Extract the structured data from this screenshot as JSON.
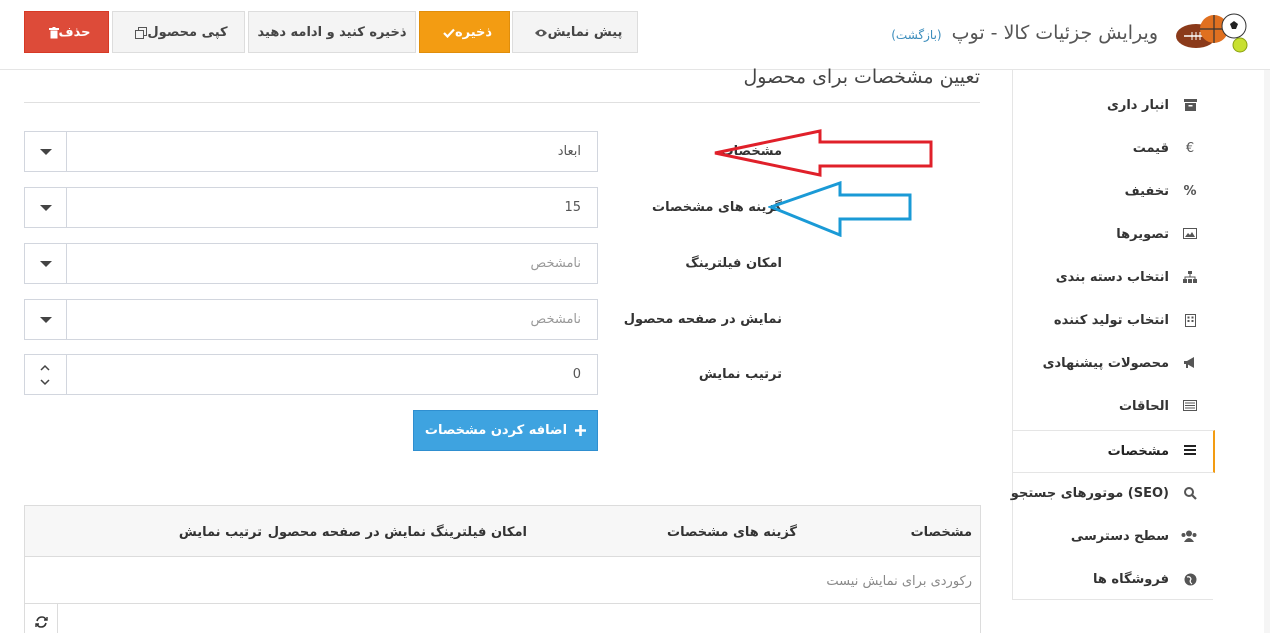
{
  "header": {
    "title": "ویرایش جزئیات کالا - توپ",
    "back_link": "(بازگشت)",
    "buttons": {
      "preview": "پیش نمایش",
      "save": "ذخیره",
      "save_continue": "ذخیره کنید و ادامه دهید",
      "copy": "کپی محصول",
      "delete": "حذف"
    }
  },
  "sidebar": {
    "items": [
      {
        "label": "انبار داری",
        "icon": "archive-icon"
      },
      {
        "label": "قیمت",
        "icon": "euro-icon"
      },
      {
        "label": "تخفیف",
        "icon": "percent-icon"
      },
      {
        "label": "تصویرها",
        "icon": "image-icon"
      },
      {
        "label": "انتخاب دسته بندی",
        "icon": "sitemap-icon"
      },
      {
        "label": "انتخاب تولید کننده",
        "icon": "building-icon"
      },
      {
        "label": "محصولات پیشنهادی",
        "icon": "bullhorn-icon"
      },
      {
        "label": "الحاقات",
        "icon": "list-alt-icon"
      },
      {
        "label": "مشخصات",
        "icon": "list-icon",
        "active": true
      },
      {
        "label": "(SEO) موتورهای جستجو",
        "icon": "search-icon"
      },
      {
        "label": "سطح دسترسی",
        "icon": "users-icon"
      },
      {
        "label": "فروشگاه ها",
        "icon": "globe-icon"
      }
    ]
  },
  "main": {
    "section_title": "تعیین مشخصات برای محصول",
    "fields": {
      "attribute": {
        "label": "مشخصات",
        "value": "ابعاد"
      },
      "attribute_option": {
        "label": "گزینه های مشخصات",
        "value": "15"
      },
      "allow_filtering": {
        "label": "امکان فیلترینگ",
        "placeholder": "نامشخص"
      },
      "show_on_product_page": {
        "label": "نمایش در صفحه محصول",
        "placeholder": "نامشخص"
      },
      "display_order": {
        "label": "ترتیب نمایش",
        "value": "0"
      }
    },
    "add_button": "اضافه کردن مشخصات"
  },
  "table": {
    "columns": [
      "مشخصات",
      "گزینه های مشخصات",
      "امکان فیلترینگ",
      "نمایش در صفحه محصول",
      "ترتیب نمایش"
    ],
    "empty_message": "رکوردی برای نمایش نیست"
  },
  "annotations": {
    "red_arrow_color": "#e0202a",
    "blue_arrow_color": "#1a9ad6"
  }
}
